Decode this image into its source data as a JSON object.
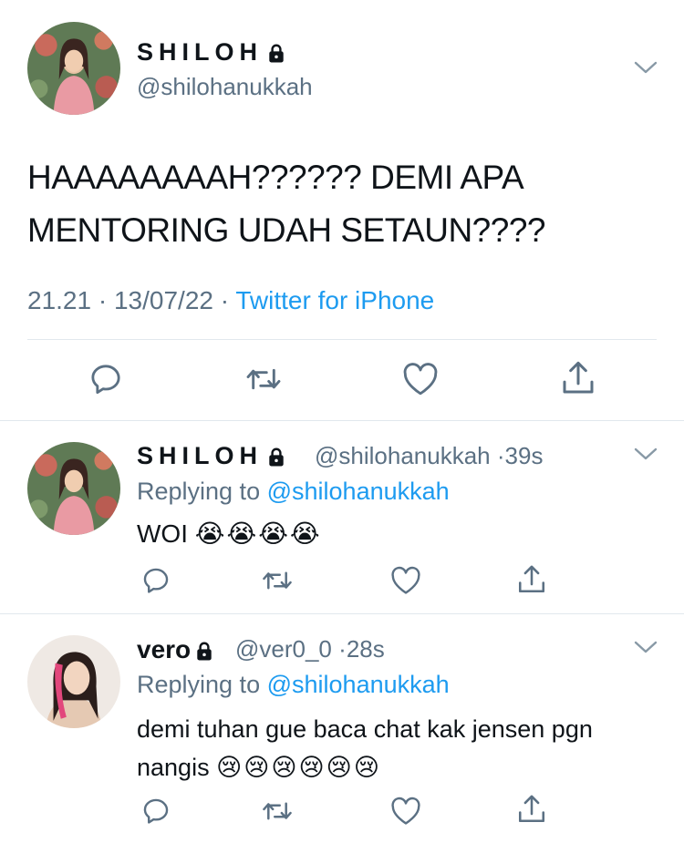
{
  "main_tweet": {
    "display_name": "SHILOH",
    "handle": "@shilohanukkah",
    "text_line1": "HAAAAAAAAH?????? DEMI APA",
    "text_line2": "MENTORING UDAH SETAUN????",
    "time": "21.21",
    "date": "13/07/22",
    "source": "Twitter for iPhone",
    "separator": "·"
  },
  "replies": [
    {
      "display_name": "SHILOH",
      "handle": "@shilohanukkah",
      "age": "39s",
      "replying_label": "Replying to",
      "replying_handle": "@shilohanukkah",
      "text": "WOI",
      "emoji": "😭😭😭😭"
    },
    {
      "display_name": "vero",
      "handle": "@ver0_0",
      "age": "28s",
      "replying_label": "Replying to",
      "replying_handle": "@shilohanukkah",
      "text_line1": "demi tuhan gue baca chat kak jensen pgn",
      "text_line2": "nangis",
      "emoji": "😢😢😢😢😢😢"
    }
  ],
  "icons": {
    "reply": "reply-icon",
    "retweet": "retweet-icon",
    "like": "heart-icon",
    "share": "share-icon",
    "more": "chevron-down-icon",
    "protected": "lock-icon"
  },
  "colors": {
    "text": "#0f1419",
    "secondary": "#5b7083",
    "link": "#1d9bf0",
    "divider": "#e1e8ed"
  }
}
